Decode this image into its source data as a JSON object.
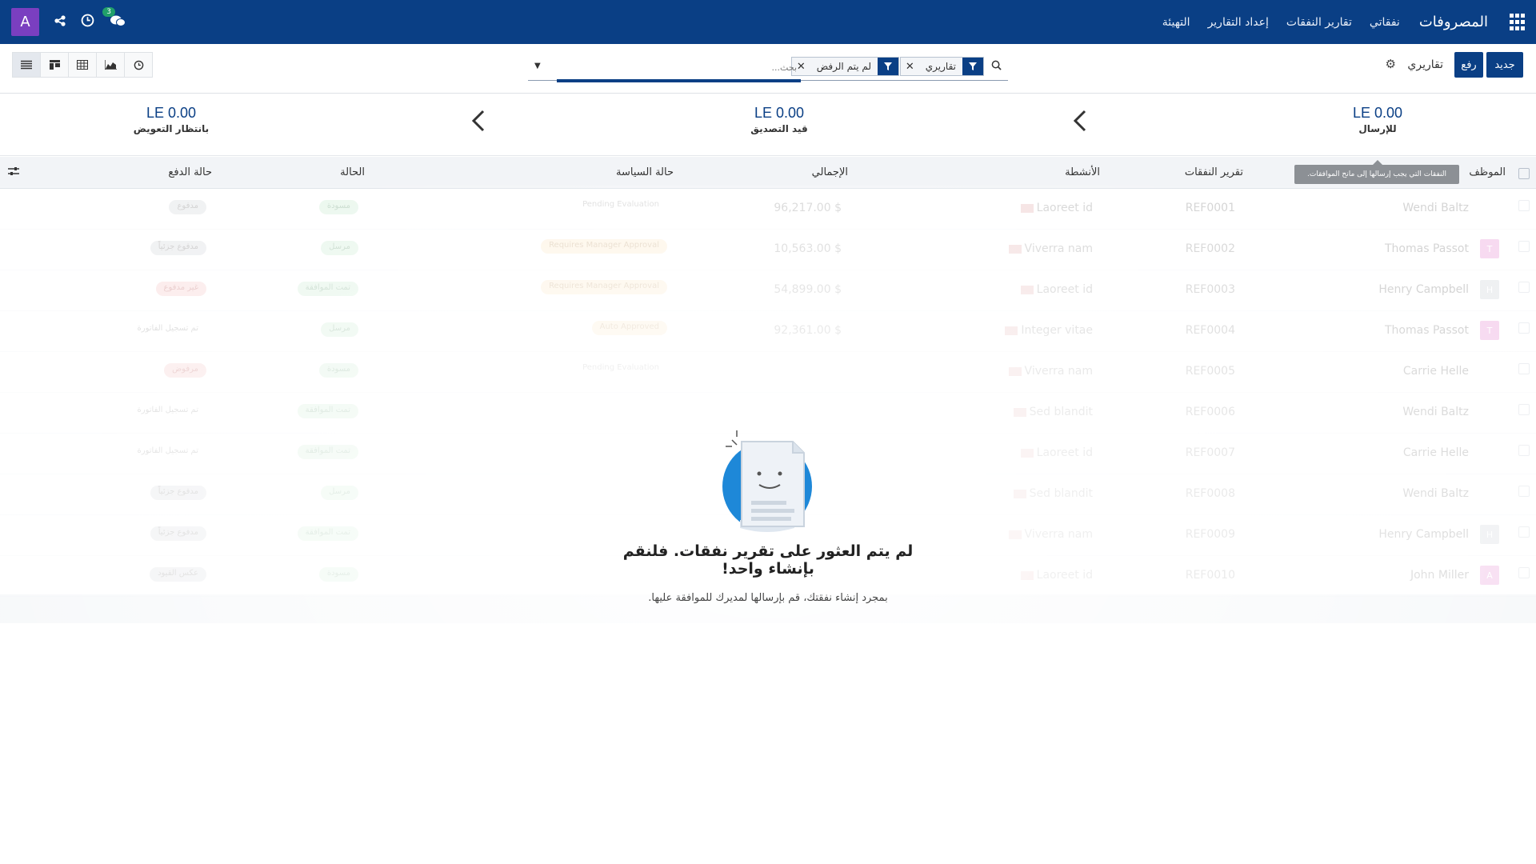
{
  "navbar": {
    "brand": "المصروفات",
    "menu": [
      "نفقاتي",
      "تقارير النفقات",
      "إعداد التقارير",
      "التهيئة"
    ],
    "user_initial": "A",
    "messages_count": "3"
  },
  "control": {
    "new_label": "جديد",
    "upload_label": "رفع",
    "reports_label": "تقاريري",
    "facets": [
      "تقاريري",
      "لم يتم الرفض"
    ],
    "search_placeholder": "بحث..."
  },
  "stats": [
    {
      "amount": "LE 0.00",
      "label": "للإرسال"
    },
    {
      "amount": "LE 0.00",
      "label": "قيد التصديق"
    },
    {
      "amount": "LE 0.00",
      "label": "بانتظار التعويض"
    }
  ],
  "tooltip": "النفقات التي يجب إرسالها إلى مانح الموافقات.",
  "table": {
    "headers": {
      "employee": "الموظف",
      "report": "تقرير النفقات",
      "activities": "الأنشطة",
      "total": "الإجمالي",
      "policy": "حالة السياسة",
      "status": "الحالة",
      "payment": "حالة الدفع"
    },
    "rows": [
      {
        "employee": "Wendi Baltz",
        "avatar": "",
        "ref": "REF0001",
        "activity": "Laoreet id",
        "total": "$ 96,217.00",
        "policy": "Pending Evaluation",
        "policy_color": "none",
        "status": "مسودة",
        "status_color": "green",
        "payment": "مدفوع",
        "payment_color": "grey"
      },
      {
        "employee": "Thomas Passot",
        "avatar": "T",
        "ref": "REF0002",
        "activity": "Viverra nam",
        "total": "$ 10,563.00",
        "policy": "Requires Manager Approval",
        "policy_color": "orange",
        "status": "مرسل",
        "status_color": "green",
        "payment": "مدفوع جزئياً",
        "payment_color": "grey"
      },
      {
        "employee": "Henry Campbell",
        "avatar": "H",
        "ref": "REF0003",
        "activity": "Laoreet id",
        "total": "$ 54,899.00",
        "policy": "Requires Manager Approval",
        "policy_color": "orange",
        "status": "تمت الموافقة",
        "status_color": "green",
        "payment": "غير مدفوع",
        "payment_color": "red"
      },
      {
        "employee": "Thomas Passot",
        "avatar": "T",
        "ref": "REF0004",
        "activity": "Integer vitae",
        "total": "$ 92,361.00",
        "policy": "Auto Approved",
        "policy_color": "orange",
        "status": "مرسل",
        "status_color": "green",
        "payment": "تم تسجيل الفاتورة",
        "payment_color": "none"
      },
      {
        "employee": "Carrie Helle",
        "avatar": "",
        "ref": "REF0005",
        "activity": "Viverra nam",
        "total": "",
        "policy": "Pending Evaluation",
        "policy_color": "none",
        "status": "مسودة",
        "status_color": "green",
        "payment": "مرفوض",
        "payment_color": "red"
      },
      {
        "employee": "Wendi Baltz",
        "avatar": "",
        "ref": "REF0006",
        "activity": "Sed blandit",
        "total": "",
        "policy": "",
        "policy_color": "none",
        "status": "تمت الموافقة",
        "status_color": "green",
        "payment": "تم تسجيل الفاتورة",
        "payment_color": "none"
      },
      {
        "employee": "Carrie Helle",
        "avatar": "",
        "ref": "REF0007",
        "activity": "Laoreet id",
        "total": "",
        "policy": "",
        "policy_color": "none",
        "status": "تمت الموافقة",
        "status_color": "green",
        "payment": "تم تسجيل الفاتورة",
        "payment_color": "none"
      },
      {
        "employee": "Wendi Baltz",
        "avatar": "",
        "ref": "REF0008",
        "activity": "Sed blandit",
        "total": "",
        "policy": "",
        "policy_color": "none",
        "status": "مرسل",
        "status_color": "green",
        "payment": "مدفوع جزئياً",
        "payment_color": "grey"
      },
      {
        "employee": "Henry Campbell",
        "avatar": "H",
        "ref": "REF0009",
        "activity": "Viverra nam",
        "total": "",
        "policy": "",
        "policy_color": "none",
        "status": "تمت الموافقة",
        "status_color": "green",
        "payment": "مدفوع جزئياً",
        "payment_color": "grey"
      },
      {
        "employee": "John Miller",
        "avatar": "A",
        "ref": "REF0010",
        "activity": "Laoreet id",
        "total": "",
        "policy": "",
        "policy_color": "none",
        "status": "مسودة",
        "status_color": "green",
        "payment": "عكس القيود",
        "payment_color": "grey"
      }
    ]
  },
  "empty_state": {
    "title": "لم يتم العثور على تقرير نفقات. فلنقم بإنشاء واحد!",
    "subtitle": "بمجرد إنشاء نفقتك، قم بإرسالها لمديرك للموافقة عليها."
  }
}
